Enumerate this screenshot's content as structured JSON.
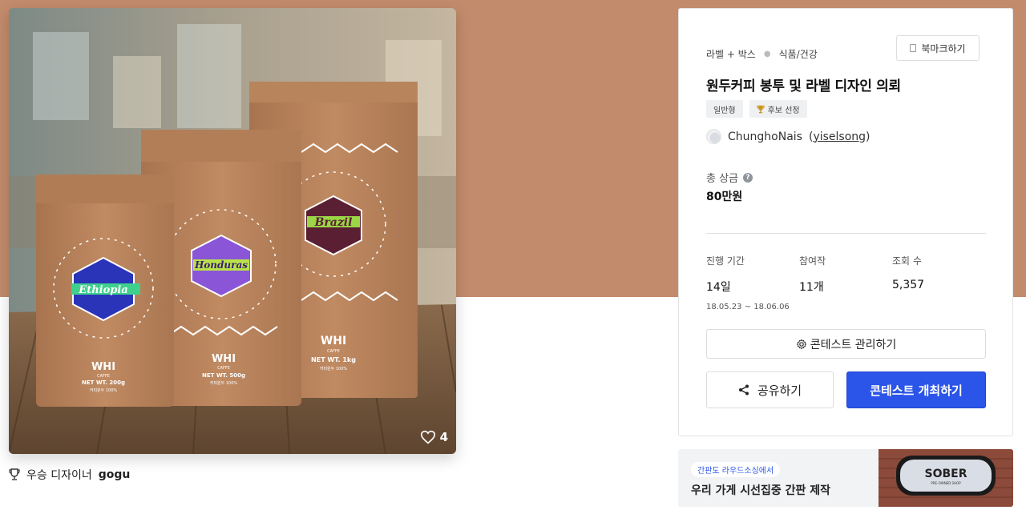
{
  "hero": {
    "like_count": "4",
    "bags": [
      {
        "brand": "WHI",
        "sub": "CAFFE",
        "weight": "NET WT. 200g",
        "desc": "커피원두 100%",
        "origin": "Ethiopia"
      },
      {
        "brand": "WHI",
        "sub": "CAFFE",
        "weight": "NET WT. 500g",
        "desc": "커피원두 100%",
        "origin": "Honduras"
      },
      {
        "brand": "WHI",
        "sub": "CAFFE",
        "weight": "NET WT. 1kg",
        "desc": "커피원두 100%",
        "origin": "Brazil"
      }
    ]
  },
  "winner": {
    "prefix": "우승 디자이너",
    "name": "gogu"
  },
  "panel": {
    "category": "라벨 + 박스",
    "subcategory": "식품/건강",
    "bookmark_label": "북마크하기",
    "title": "원두커피 봉투 및 라벨 디자인 의뢰",
    "tags": [
      "일반형",
      "후보 선정"
    ],
    "author_name": "ChunghoNais",
    "author_id": "yiselsong",
    "prize_label": "총 상금",
    "prize_value": "80만원",
    "stats": [
      {
        "label": "진행 기간",
        "value": "14일",
        "sub": "18.05.23 ~ 18.06.06"
      },
      {
        "label": "참여작",
        "value": "11개",
        "sub": ""
      },
      {
        "label": "조회 수",
        "value": "5,357",
        "sub": ""
      }
    ],
    "manage_label": "콘테스트 관리하기",
    "share_label": "공유하기",
    "host_label": "콘테스트 개최하기"
  },
  "banner": {
    "chip": "간판도 라우드소싱에서",
    "title": "우리 가게 시선집중 간판 제작",
    "sign_text": "SOBER",
    "sign_sub": "PRE-OWNED SHOP"
  },
  "colors": {
    "band": "#c28b6c",
    "primary": "#2b55e8"
  }
}
